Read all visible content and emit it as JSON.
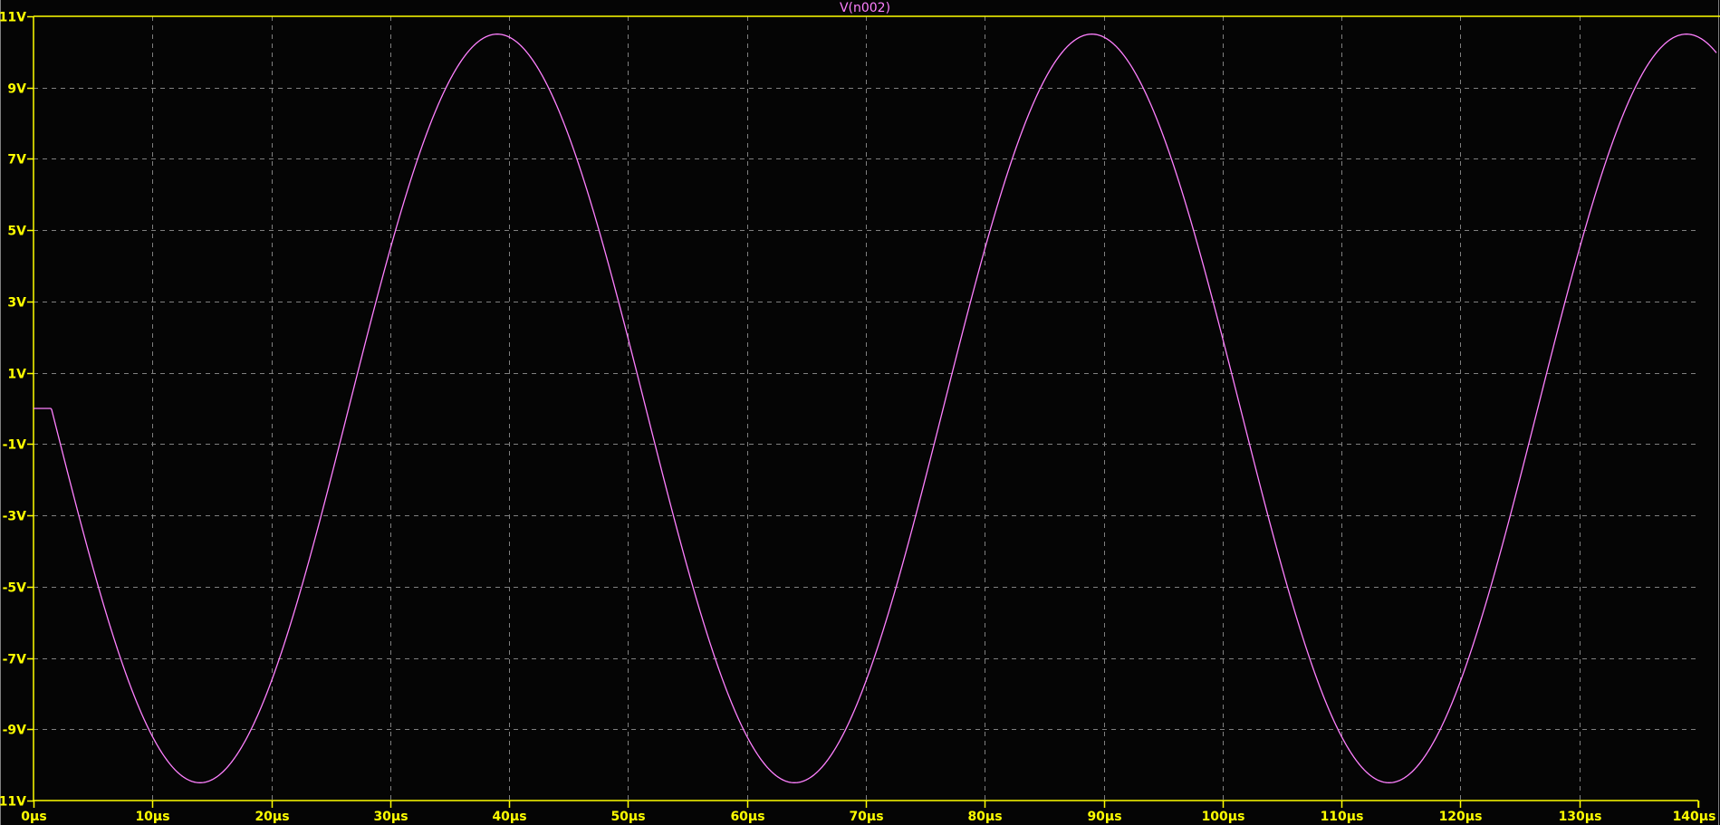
{
  "colors": {
    "background": "#050505",
    "axis": "#ffff00",
    "grid": "#808080",
    "trace": "#ff80ff",
    "border": "#808080"
  },
  "chart_data": {
    "type": "line",
    "title": "V(n002)",
    "xlabel": "",
    "ylabel": "",
    "xlim": [
      0,
      140
    ],
    "ylim": [
      -11,
      11
    ],
    "x_unit": "µs",
    "y_unit": "V",
    "grid": true,
    "xticks": [
      "0µs",
      "10µs",
      "20µs",
      "30µs",
      "40µs",
      "50µs",
      "60µs",
      "70µs",
      "80µs",
      "90µs",
      "100µs",
      "110µs",
      "120µs",
      "130µs",
      "140µs"
    ],
    "xtick_values": [
      0,
      10,
      20,
      30,
      40,
      50,
      60,
      70,
      80,
      90,
      100,
      110,
      120,
      130,
      140
    ],
    "yticks": [
      "11V",
      "9V",
      "7V",
      "5V",
      "3V",
      "1V",
      "-1V",
      "-3V",
      "-5V",
      "-7V",
      "-9V",
      "-11V"
    ],
    "ytick_values": [
      11,
      9,
      7,
      5,
      3,
      1,
      -1,
      -3,
      -5,
      -7,
      -9,
      -11
    ],
    "series": [
      {
        "name": "V(n002)",
        "model": {
          "shape": "sine",
          "amplitude": 10.5,
          "period": 50,
          "start": 1.5,
          "initial_value": 0,
          "sign": -1
        },
        "key_points": [
          [
            0,
            0
          ],
          [
            1.5,
            0
          ],
          [
            14,
            -10.5
          ],
          [
            26.5,
            0
          ],
          [
            39,
            10.5
          ],
          [
            51.5,
            0
          ],
          [
            64,
            -10.5
          ],
          [
            76.5,
            0
          ],
          [
            89,
            10.5
          ],
          [
            101.5,
            0
          ],
          [
            114,
            -10.5
          ],
          [
            126.5,
            0
          ],
          [
            139,
            10.5
          ],
          [
            140,
            10.48
          ]
        ]
      }
    ]
  }
}
